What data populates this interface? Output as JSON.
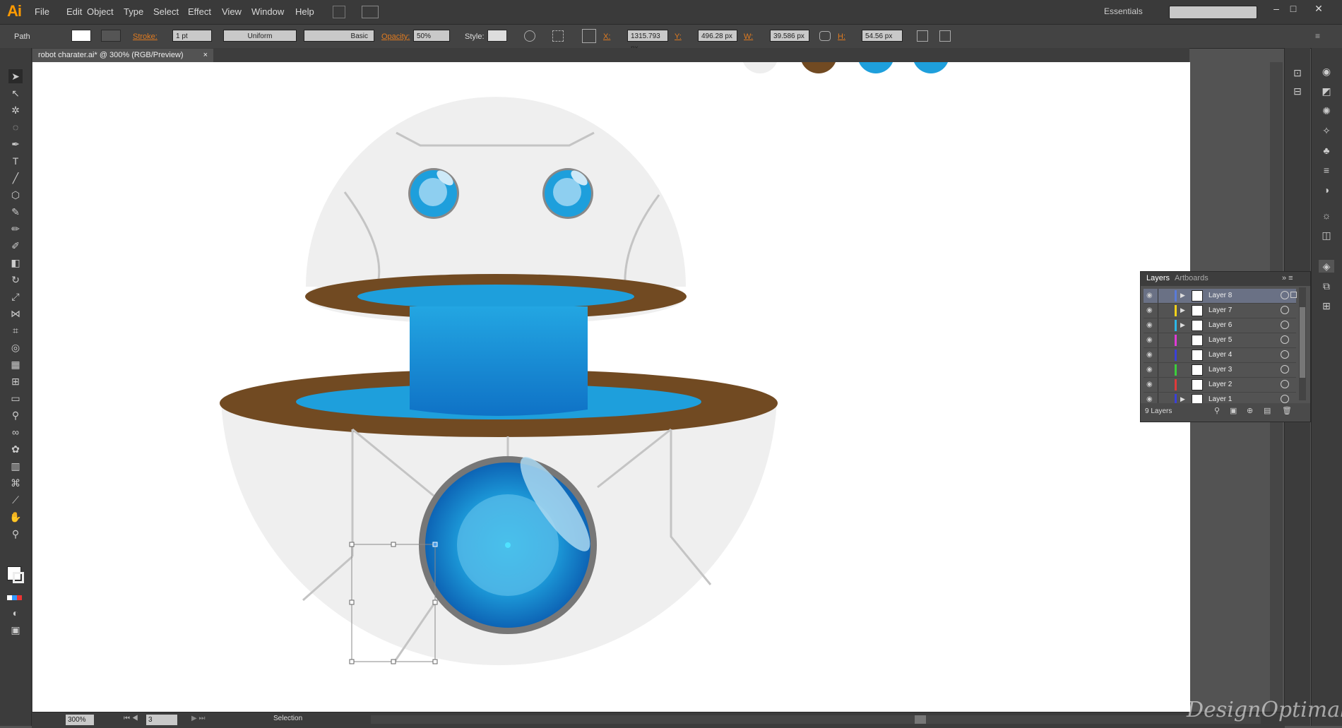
{
  "app": {
    "logo": "Ai",
    "workspace": "Essentials"
  },
  "menu": [
    "File",
    "Edit",
    "Object",
    "Type",
    "Select",
    "Effect",
    "View",
    "Window",
    "Help"
  ],
  "control": {
    "selection_type": "Path",
    "stroke_label": "Stroke:",
    "stroke_weight": "1 pt",
    "profile": "Uniform",
    "brush": "Basic",
    "opacity_label": "Opacity:",
    "opacity": "50%",
    "style_label": "Style:",
    "x_label": "X:",
    "x": "1315.793 px",
    "y_label": "Y:",
    "y": "496.28 px",
    "w_label": "W:",
    "w": "39.586 px",
    "h_label": "H:",
    "h": "54.56 px"
  },
  "document": {
    "tab_title": "robot charater.ai* @ 300% (RGB/Preview)",
    "close": "×"
  },
  "layers_panel": {
    "tabs": [
      "Layers",
      "Artboards"
    ],
    "layers": [
      {
        "name": "Layer 8",
        "color": "#5a7bd8",
        "expandable": true
      },
      {
        "name": "Layer 7",
        "color": "#f2d21b",
        "expandable": true
      },
      {
        "name": "Layer 6",
        "color": "#2db7e8",
        "expandable": true
      },
      {
        "name": "Layer 5",
        "color": "#e03ad6",
        "expandable": false
      },
      {
        "name": "Layer 4",
        "color": "#3a40d8",
        "expandable": false
      },
      {
        "name": "Layer 3",
        "color": "#3ccf3c",
        "expandable": false
      },
      {
        "name": "Layer 2",
        "color": "#e03a3a",
        "expandable": false
      },
      {
        "name": "Layer 1",
        "color": "#3a40d8",
        "expandable": true
      }
    ],
    "count": "9 Layers"
  },
  "status": {
    "zoom": "300%",
    "artboard": "3",
    "tool": "Selection"
  },
  "watermark": "DesignOptimal.com",
  "colors": {
    "brown": "#714a22",
    "blue": "#1e9fdc",
    "shell": "#efefef"
  }
}
